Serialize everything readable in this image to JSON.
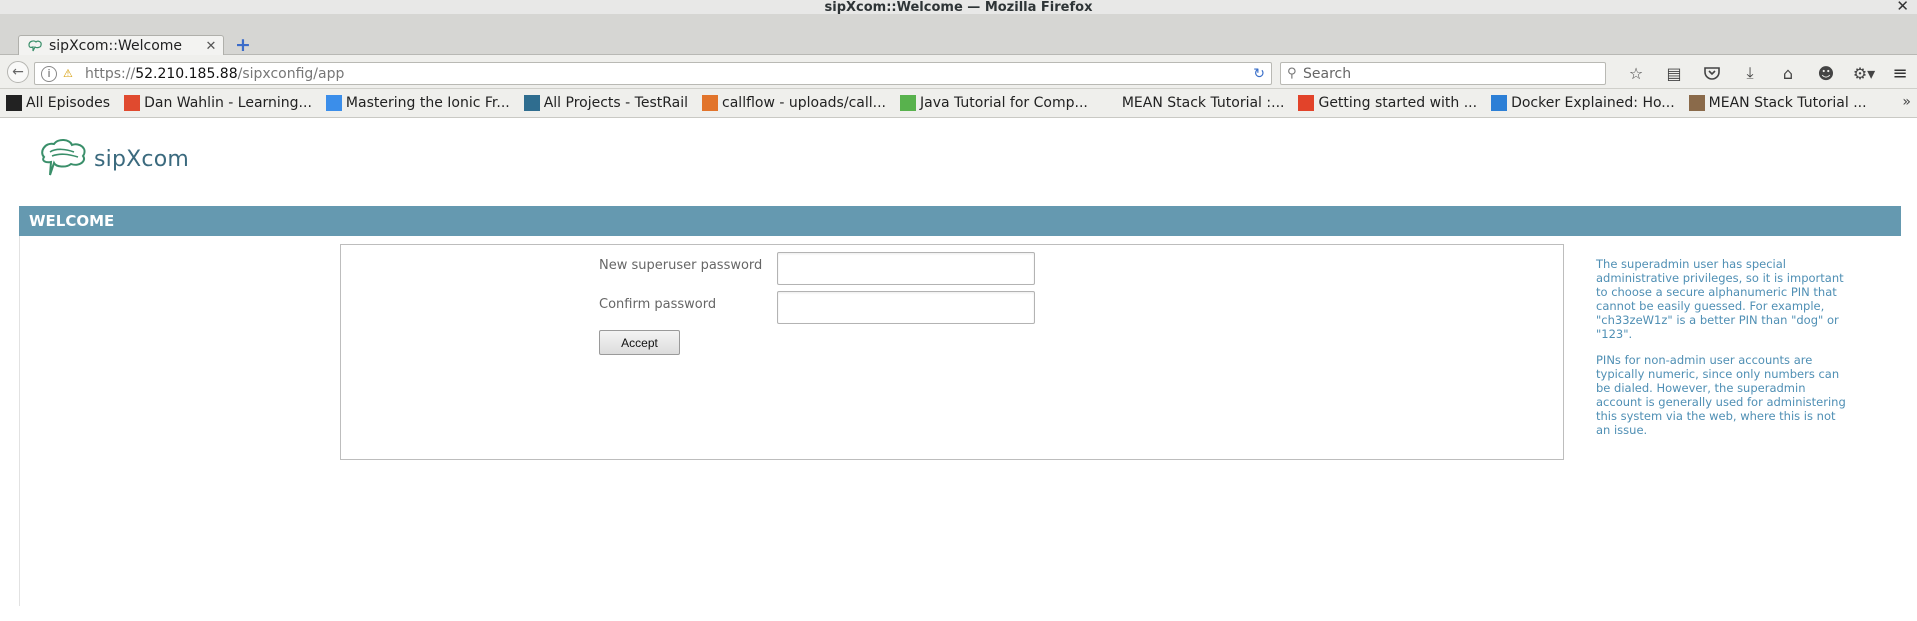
{
  "window": {
    "title": "sipXcom::Welcome — Mozilla Firefox",
    "close_glyph": "✕"
  },
  "tab": {
    "title": "sipXcom::Welcome",
    "close_glyph": "✕",
    "new_tab_glyph": "+"
  },
  "navbar": {
    "back_glyph": "←",
    "url_prefix": "https://",
    "url_host": "52.210.185.88",
    "url_path": "/sipxconfig/app",
    "reload_glyph": "↻",
    "search_placeholder": "Search",
    "toolbar_icons": [
      "bookmark-star-icon",
      "reading-list-icon",
      "pocket-icon",
      "download-icon",
      "home-icon",
      "chat-icon",
      "addons-icon"
    ],
    "menu_glyph": "≡"
  },
  "bookmarks": [
    {
      "label": "All Episodes",
      "icon": "terminal-icon",
      "color": "#222222"
    },
    {
      "label": "Dan Wahlin - Learning...",
      "icon": "windows-icon",
      "color": "#e04a2f"
    },
    {
      "label": "Mastering the Ionic Fr...",
      "icon": "ionic-icon",
      "color": "#3b8eea"
    },
    {
      "label": "All Projects - TestRail",
      "icon": "testrail-icon",
      "color": "#2f6d8f"
    },
    {
      "label": "callflow - uploads/call...",
      "icon": "git-icon",
      "color": "#e2742b"
    },
    {
      "label": "Java Tutorial for Comp...",
      "icon": "udemy-icon",
      "color": "#58b24d"
    },
    {
      "label": "MEAN Stack Tutorial :...",
      "icon": "",
      "color": "#ffffff"
    },
    {
      "label": "Getting started with ...",
      "icon": "gitlab-icon",
      "color": "#e2432a"
    },
    {
      "label": "Docker Explained: Ho...",
      "icon": "digitalocean-icon",
      "color": "#2c7fd6"
    },
    {
      "label": "MEAN Stack Tutorial ...",
      "icon": "avatar-icon",
      "color": "#8a6a4a"
    }
  ],
  "bookmarks_overflow_glyph": "»",
  "page": {
    "logo_text": "sipXcom",
    "section_title": "WELCOME",
    "form": {
      "new_password_label": "New superuser password",
      "confirm_password_label": "Confirm password",
      "accept_label": "Accept"
    },
    "help": [
      "The superadmin user has special administrative privileges, so it is important to choose a secure alphanumeric PIN that cannot be easily guessed. For example, \"ch33zeW1z\" is a better PIN than \"dog\" or \"123\".",
      "PINs for non-admin user accounts are typically numeric, since only numbers can be dialed. However, the superadmin account is generally used for administering this system via the web, where this is not an issue."
    ]
  },
  "colors": {
    "header_bar": "#6599b0",
    "help_text": "#4f8fb4",
    "logo": "#3b6a7e"
  }
}
